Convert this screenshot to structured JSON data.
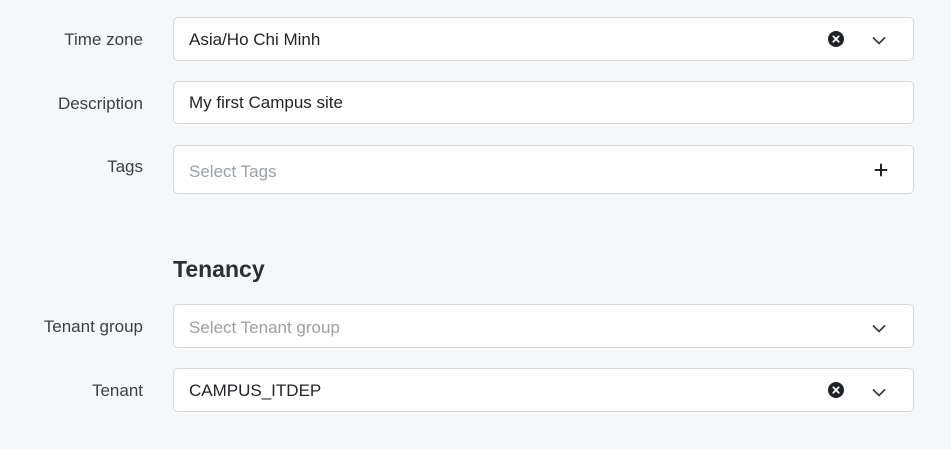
{
  "timezone": {
    "label": "Time zone",
    "value": "Asia/Ho Chi Minh"
  },
  "description": {
    "label": "Description",
    "value": "My first Campus site"
  },
  "tags": {
    "label": "Tags",
    "placeholder": "Select Tags"
  },
  "tenancy": {
    "heading": "Tenancy",
    "tenant_group": {
      "label": "Tenant group",
      "placeholder": "Select Tenant group"
    },
    "tenant": {
      "label": "Tenant",
      "value": "CAMPUS_ITDEP"
    }
  },
  "icons": {
    "clear": "close-circle-icon",
    "dropdown": "chevron-down-icon",
    "add": "plus-icon"
  }
}
